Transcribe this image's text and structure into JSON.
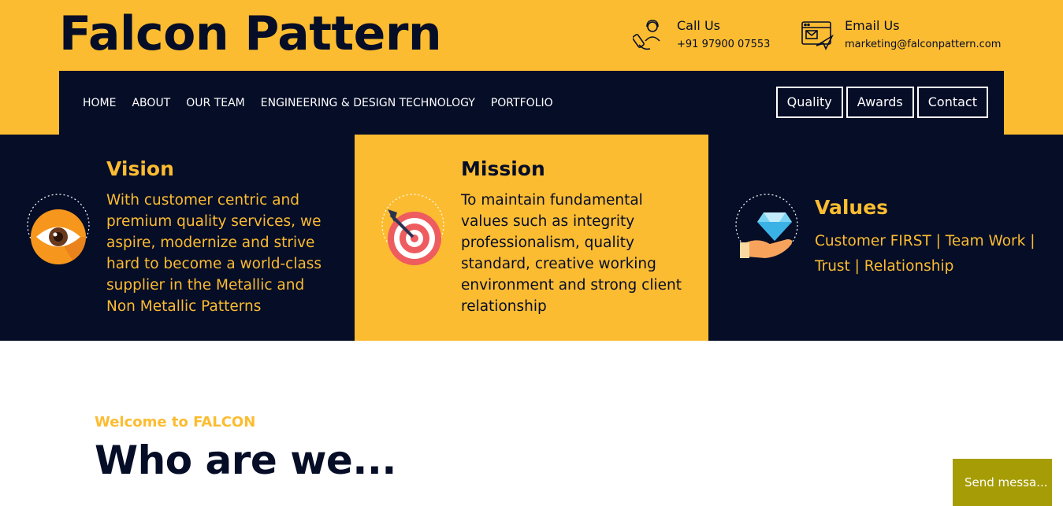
{
  "header": {
    "brand": "Falcon Pattern",
    "call": {
      "label": "Call Us",
      "value": "+91 97900 07553",
      "icon": "phone-support-icon"
    },
    "email": {
      "label": "Email Us",
      "value": "marketing@falconpattern.com",
      "icon": "email-icon"
    }
  },
  "nav": {
    "items": [
      {
        "label": "HOME"
      },
      {
        "label": "ABOUT"
      },
      {
        "label": "OUR TEAM"
      },
      {
        "label": "ENGINEERING & DESIGN TECHNOLOGY"
      },
      {
        "label": "PORTFOLIO"
      }
    ],
    "buttons": [
      {
        "label": "Quality"
      },
      {
        "label": "Awards"
      },
      {
        "label": "Contact"
      }
    ]
  },
  "vision": {
    "title": "Vision",
    "text": "With customer centric and premium quality services, we aspire, modernize and strive hard to become a world-class supplier in the Metallic and Non Metallic Patterns",
    "icon": "eye-icon"
  },
  "mission": {
    "title": "Mission",
    "text": "To maintain fundamental values such as integrity professionalism, quality standard, creative working environment and strong client relationship",
    "icon": "target-icon"
  },
  "values": {
    "title": "Values",
    "text": "Customer FIRST | Team Work | Trust | Relationship",
    "icon": "diamond-hand-icon"
  },
  "about": {
    "welcome": "Welcome to FALCON",
    "heading": "Who are we..."
  },
  "chat": {
    "label": "Send messa..."
  },
  "colors": {
    "accent": "#fcbc31",
    "navy": "#050d27",
    "chat": "#a69d06"
  }
}
